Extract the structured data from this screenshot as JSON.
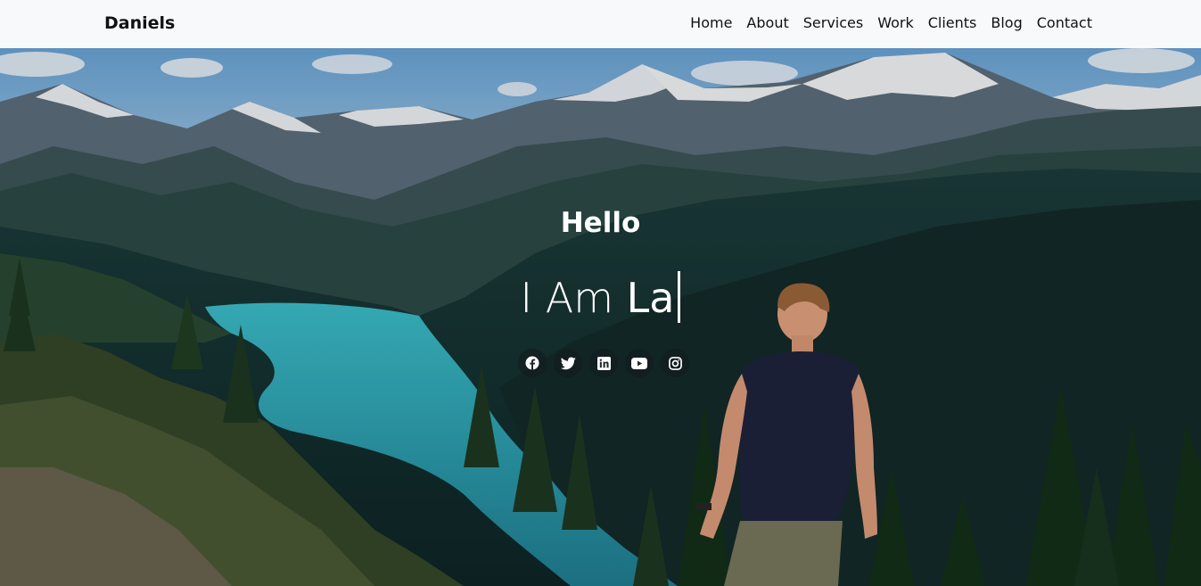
{
  "nav": {
    "brand": "Daniels",
    "links": [
      "Home",
      "About",
      "Services",
      "Work",
      "Clients",
      "Blog",
      "Contact"
    ]
  },
  "hero": {
    "greeting": "Hello",
    "prefix": "I Am",
    "typed": "La",
    "socials": [
      "facebook-icon",
      "twitter-icon",
      "linkedin-icon",
      "youtube-icon",
      "instagram-icon"
    ]
  },
  "colors": {
    "navbar_bg": "#f8f9fa",
    "text_on_hero": "#ffffff",
    "lake": "#2aa3b5",
    "sky": "#7ab3de"
  }
}
